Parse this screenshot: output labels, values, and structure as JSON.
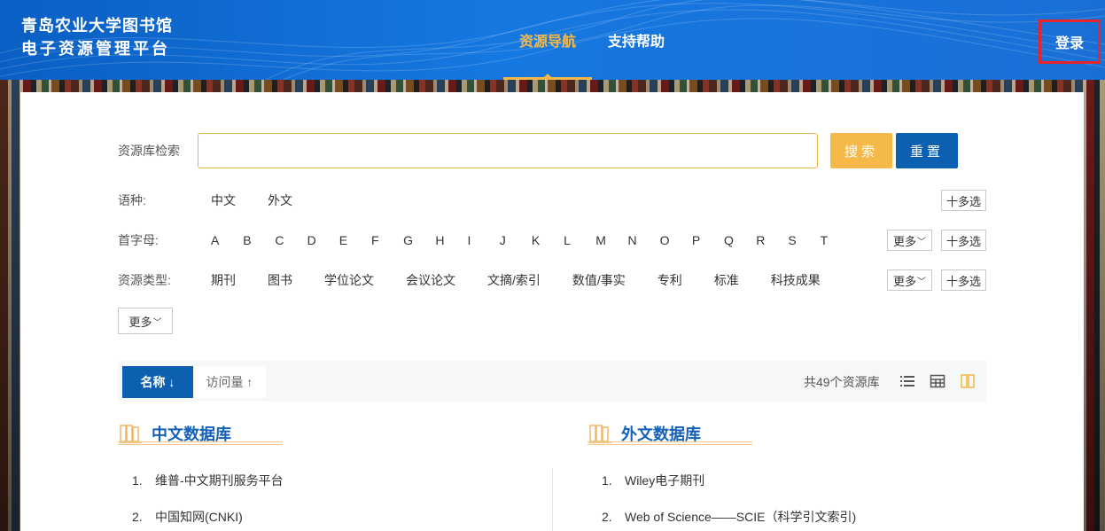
{
  "header": {
    "title_line1": "青岛农业大学图书馆",
    "title_line2": "电子资源管理平台",
    "nav": [
      {
        "label": "资源导航",
        "active": true
      },
      {
        "label": "支持帮助",
        "active": false
      }
    ],
    "login_label": "登录"
  },
  "search": {
    "label": "资源库检索",
    "value": "",
    "placeholder": "",
    "search_button": "搜索",
    "reset_button": "重置"
  },
  "filters": {
    "language": {
      "label": "语种:",
      "options": [
        "中文",
        "外文"
      ],
      "multi_label": "十多选"
    },
    "initial": {
      "label": "首字母:",
      "options": [
        "A",
        "B",
        "C",
        "D",
        "E",
        "F",
        "G",
        "H",
        "I",
        "J",
        "K",
        "L",
        "M",
        "N",
        "O",
        "P",
        "Q",
        "R",
        "S",
        "T"
      ],
      "more_label": "更多",
      "multi_label": "十多选"
    },
    "type": {
      "label": "资源类型:",
      "options": [
        "期刊",
        "图书",
        "学位论文",
        "会议论文",
        "文摘/索引",
        "数值/事实",
        "专利",
        "标准",
        "科技成果"
      ],
      "more_label": "更多",
      "multi_label": "十多选"
    },
    "extra_more_label": "更多"
  },
  "sortbar": {
    "name_label": "名称 ↓",
    "visit_label": "访问量 ↑",
    "count_text": "共49个资源库",
    "views": [
      "list-view-icon",
      "table-view-icon",
      "card-view-icon"
    ]
  },
  "sections": [
    {
      "title": "中文数据库",
      "items": [
        {
          "num": "1.",
          "name": "维普-中文期刊服务平台"
        },
        {
          "num": "2.",
          "name": "中国知网(CNKI)"
        }
      ]
    },
    {
      "title": "外文数据库",
      "items": [
        {
          "num": "1.",
          "name": "Wiley电子期刊"
        },
        {
          "num": "2.",
          "name": "Web of Science——SCIE（科学引文索引)"
        }
      ]
    }
  ],
  "colors": {
    "primary": "#0d5fb0",
    "accent": "#f5b94a",
    "highlight_border": "#e8242b"
  }
}
